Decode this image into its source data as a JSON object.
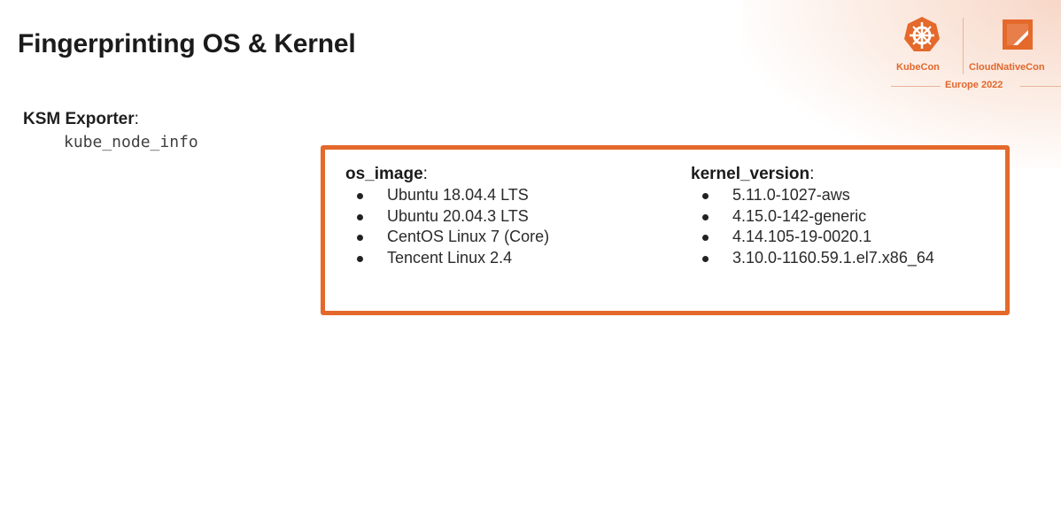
{
  "slide": {
    "title": "Fingerprinting OS & Kernel"
  },
  "logo": {
    "kubecon": "KubeCon",
    "cloudnativecon": "CloudNativeCon",
    "event": "Europe 2022",
    "accent_color": "#e4692b"
  },
  "exporter": {
    "label": "KSM Exporter",
    "colon": ":",
    "metric": "kube_node_info"
  },
  "os_image": {
    "heading": "os_image",
    "items": [
      "Ubuntu 18.04.4 LTS",
      "Ubuntu 20.04.3 LTS",
      "CentOS Linux 7 (Core)",
      "Tencent Linux 2.4"
    ]
  },
  "kernel_version": {
    "heading": "kernel_version",
    "items": [
      "5.11.0-1027-aws",
      "4.15.0-142-generic",
      "4.14.105-19-0020.1",
      "3.10.0-1160.59.1.el7.x86_64"
    ]
  }
}
